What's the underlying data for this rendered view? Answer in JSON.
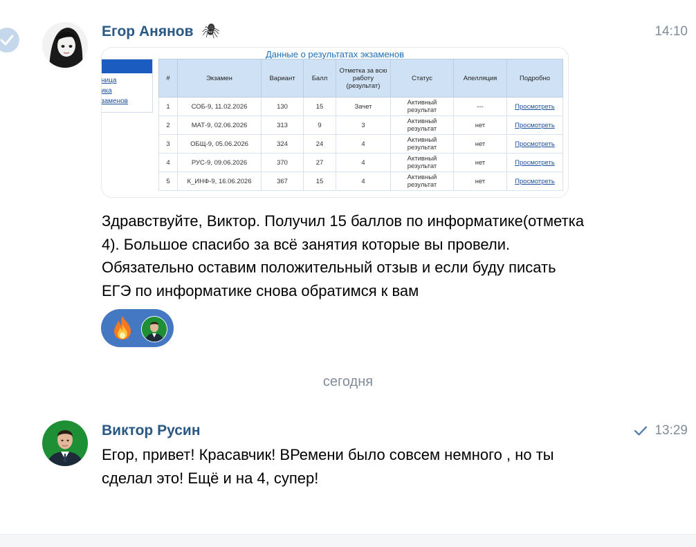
{
  "messages": [
    {
      "author": "Егор Анянов",
      "author_emoji": "🕷",
      "time": "14:10",
      "attachment": {
        "title": "Данные о результатах экзаменов",
        "side_links": [
          "ница",
          "ика",
          "заменов"
        ],
        "columns": [
          "#",
          "Экзамен",
          "Вариант",
          "Балл",
          "Отметка за всю работу (результат)",
          "Статус",
          "Апелляция",
          "Подробно"
        ],
        "rows": [
          [
            "1",
            "СОБ-9, 11.02.2026",
            "130",
            "15",
            "Зачет",
            "Активный результат",
            "---",
            "Просмотреть"
          ],
          [
            "2",
            "МАТ-9, 02.06.2026",
            "313",
            "9",
            "3",
            "Активный результат",
            "нет",
            "Просмотреть"
          ],
          [
            "3",
            "ОБЩ-9, 05.06.2026",
            "324",
            "24",
            "4",
            "Активный результат",
            "нет",
            "Просмотреть"
          ],
          [
            "4",
            "РУС-9, 09.06.2026",
            "370",
            "27",
            "4",
            "Активный результат",
            "нет",
            "Просмотреть"
          ],
          [
            "5",
            "К_ИНФ-9, 16.06.2026",
            "367",
            "15",
            "4",
            "Активный результат",
            "нет",
            "Просмотреть"
          ]
        ]
      },
      "text_lines": [
        "Здравствуйте, Виктор. Получил 15 баллов по информатике(отметка",
        "4). Большое спасибо за всё занятия которые вы провели.",
        "Обязательно оставим положительный отзыв и если буду писать",
        "ЕГЭ по информатике снова обратимся к вам"
      ],
      "reaction": {
        "emoji": "🔥"
      }
    },
    {
      "author": "Виктор Русин",
      "time": "13:29",
      "text_lines": [
        "Егор, привет! Красавчик! ВРемени было совсем немного , но ты",
        "сделал это! Ещё и на 4, супер!"
      ]
    }
  ],
  "date_separator": "сегодня",
  "colors": {
    "author": "#2a5885",
    "time": "#818c99",
    "reaction_bg": "#4478c2",
    "link": "#1a50a0"
  },
  "icons": [
    "check-circle-icon",
    "fire-reaction-icon",
    "read-check-icon"
  ]
}
